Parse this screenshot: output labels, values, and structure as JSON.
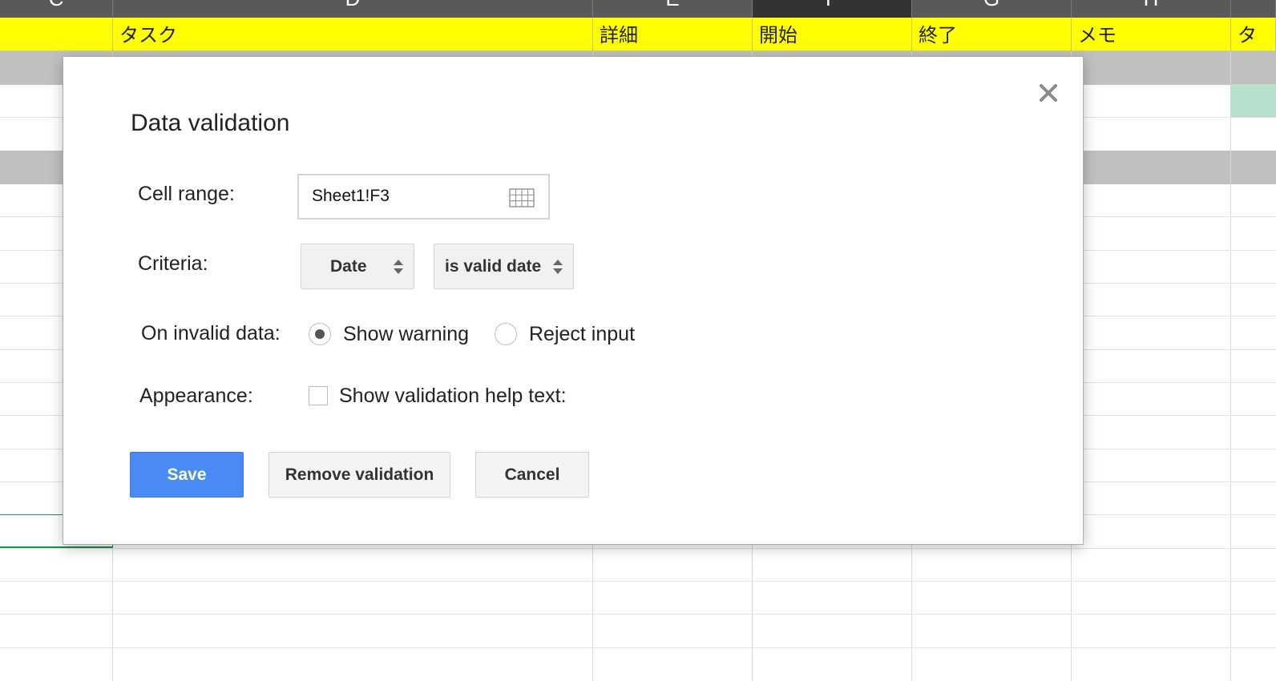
{
  "sheet": {
    "column_headers": [
      "C",
      "D",
      "E",
      "F",
      "G",
      "H",
      ""
    ],
    "active_column": "F",
    "header_row_cells": [
      "",
      "タスク",
      "詳細",
      "開始",
      "終了",
      "メモ",
      "タ"
    ],
    "colors": {
      "header_row_bg": "#ffff00",
      "column_header_bg": "#595959",
      "active_column_bg": "#333333",
      "group_band_bg": "#c0c0c0",
      "highlight_cell_bg": "#b7e1cd",
      "selection_border": "#1a8f4a"
    }
  },
  "dialog": {
    "title": "Data validation",
    "close_icon": "close-icon",
    "cell_range": {
      "label": "Cell range:",
      "value": "Sheet1!F3",
      "icon": "grid-icon"
    },
    "criteria": {
      "label": "Criteria:",
      "type": "Date",
      "condition": "is valid date"
    },
    "on_invalid": {
      "label": "On invalid data:",
      "options": [
        {
          "label": "Show warning",
          "selected": true
        },
        {
          "label": "Reject input",
          "selected": false
        }
      ]
    },
    "appearance": {
      "label": "Appearance:",
      "checkbox_label": "Show validation help text:",
      "checked": false
    },
    "buttons": {
      "save": "Save",
      "remove": "Remove validation",
      "cancel": "Cancel"
    },
    "colors": {
      "primary_button": "#4a8af4"
    }
  }
}
